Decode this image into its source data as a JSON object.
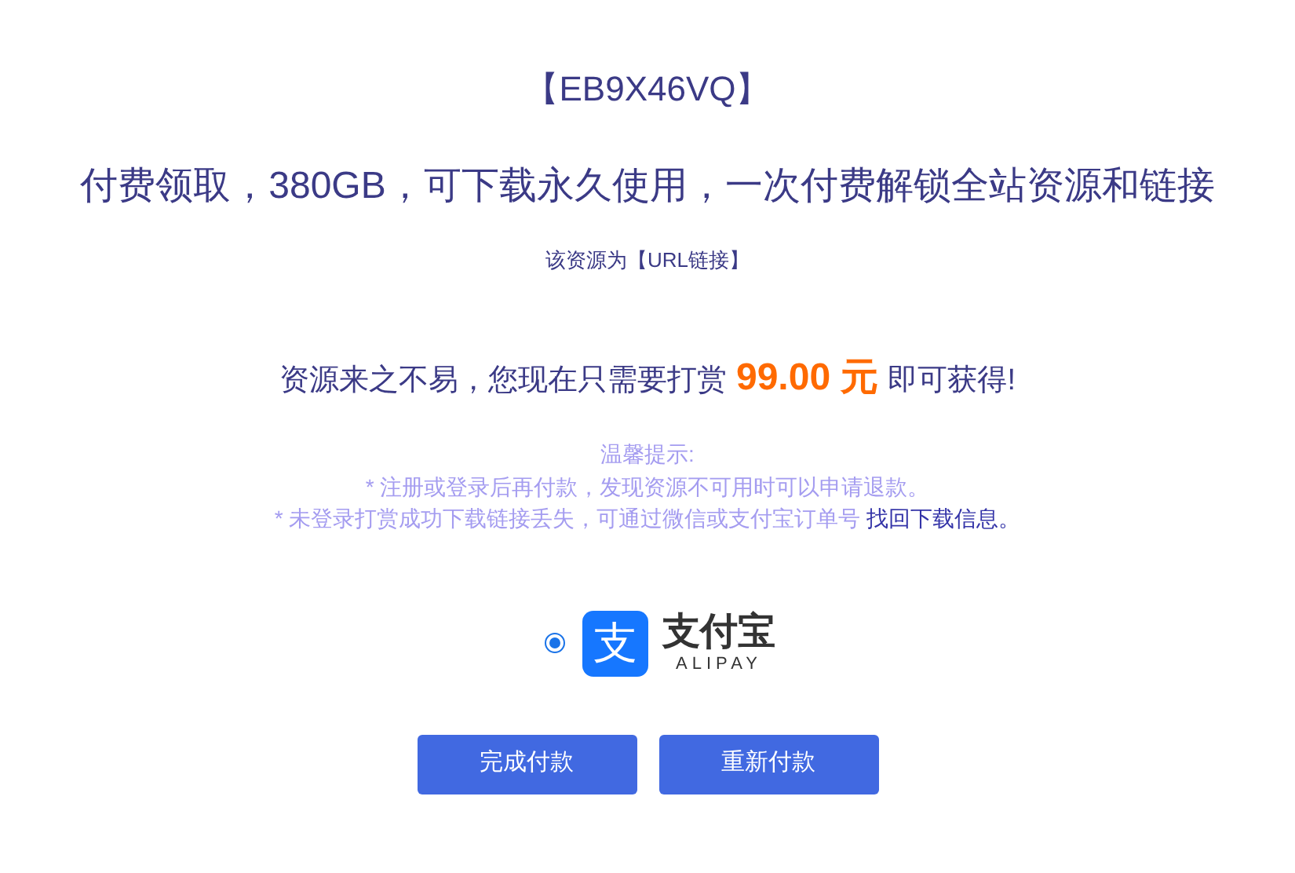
{
  "code": "【EB9X46VQ】",
  "headline": "付费领取，380GB，可下载永久使用，一次付费解锁全站资源和链接",
  "resource_type": "该资源为【URL链接】",
  "price_line": {
    "before": "资源来之不易，您现在只需要打赏",
    "amount": "99.00 元",
    "after": "即可获得!"
  },
  "tips": {
    "title": "温馨提示:",
    "lines": [
      {
        "text": "* 注册或登录后再付款，发现资源不可用时可以申请退款。"
      },
      {
        "text": "* 未登录打赏成功下载链接丢失，可通过微信或支付宝订单号",
        "link": "找回下载信息。"
      }
    ]
  },
  "payment_options": [
    {
      "icon_char": "支",
      "name": "支付宝",
      "subtitle": "ALIPAY",
      "selected": true
    }
  ],
  "buttons": [
    "完成付款",
    "重新付款"
  ]
}
